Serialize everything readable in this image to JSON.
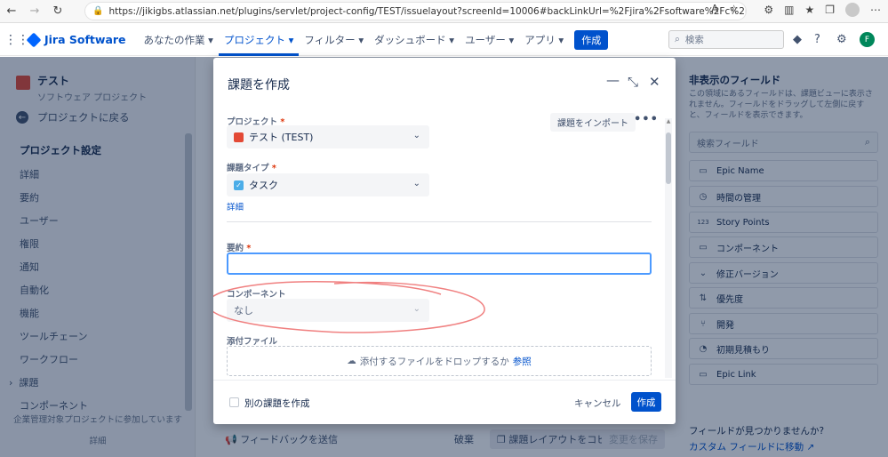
{
  "browser": {
    "url": "https://jikigbs.atlassian.net/plugins/servlet/project-config/TEST/issuelayout?screenId=10006#backLinkUrl=%2Fjira%2Fsoftware%2Fc%2Fprojects%2FTEST%2Fboards...",
    "reader_label": "A",
    "avatar_letter": ""
  },
  "header": {
    "logo": "Jira Software",
    "nav": [
      "あなたの作業",
      "プロジェクト",
      "フィルター",
      "ダッシュボード",
      "ユーザー",
      "アプリ"
    ],
    "create_label": "作成",
    "search_placeholder": "検索",
    "user_initial": "F"
  },
  "sidebar": {
    "project_name": "テスト",
    "project_type": "ソフトウェア プロジェクト",
    "back_label": "プロジェクトに戻る",
    "section_title": "プロジェクト設定",
    "items": [
      "詳細",
      "要約",
      "ユーザー",
      "権限",
      "通知",
      "自動化",
      "機能",
      "ツールチェーン",
      "ワークフロー",
      "課題",
      "コンポーネント"
    ],
    "footer_text": "企業管理対象プロジェクトに参加しています",
    "footer_link": "詳細"
  },
  "right_panel": {
    "title": "非表示のフィールド",
    "description": "この領域にあるフィールドは、課題ビューに表示されません。フィールドをドラッグして左側に戻すと、フィールドを表示できます。",
    "search_placeholder": "検索フィールド",
    "fields": [
      "Epic Name",
      "時間の管理",
      "Story Points",
      "コンポーネント",
      "修正バージョン",
      "優先度",
      "開発",
      "初期見積もり",
      "Epic Link"
    ],
    "not_found": "フィールドが見つかりませんか?",
    "custom_link": "カスタム フィールドに移動"
  },
  "bottom_bar": {
    "feedback": "フィードバックを送信",
    "discard": "破棄",
    "copy_layout": "課題レイアウトをコピー",
    "save": "変更を保存"
  },
  "modal": {
    "title": "課題を作成",
    "import_label": "課題をインポート",
    "project_label": "プロジェクト",
    "project_value": "テスト (TEST)",
    "issue_type_label": "課題タイプ",
    "issue_type_value": "タスク",
    "detail_link": "詳細",
    "summary_label": "要約",
    "summary_value": "",
    "component_label": "コンポーネント",
    "component_value": "なし",
    "attachment_label": "添付ファイル",
    "drop_text": "添付するファイルをドロップするか",
    "browse_link": "参照",
    "create_another": "別の課題を作成",
    "cancel": "キャンセル",
    "submit": "作成",
    "required_mark": "*"
  },
  "colors": {
    "primary": "#0052cc",
    "annotation": "#f08080",
    "overlay": "#091e42"
  }
}
